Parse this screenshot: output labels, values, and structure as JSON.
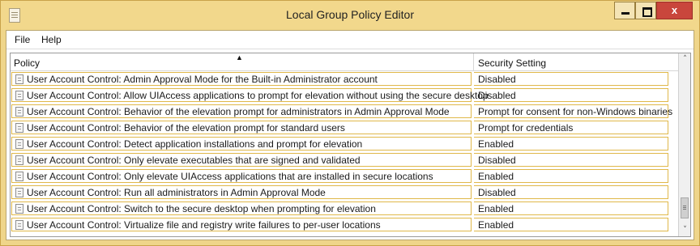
{
  "window": {
    "title": "Local Group Policy Editor",
    "close_glyph": "x",
    "icons": {
      "app": "document-icon",
      "minimize": "minimize-icon",
      "maximize": "maximize-icon",
      "close": "close-icon"
    }
  },
  "menu": {
    "items": [
      {
        "label": "File"
      },
      {
        "label": "Help"
      }
    ]
  },
  "table": {
    "columns": [
      "Policy",
      "Security Setting"
    ],
    "sort_indicator": "▲",
    "rows": [
      {
        "policy": "User Account Control: Admin Approval Mode for the Built-in Administrator account",
        "setting": "Disabled"
      },
      {
        "policy": "User Account Control: Allow UIAccess applications to prompt for elevation without using the secure desktop",
        "setting": "Disabled"
      },
      {
        "policy": "User Account Control: Behavior of the elevation prompt for administrators in Admin Approval Mode",
        "setting": "Prompt for consent for non-Windows binaries"
      },
      {
        "policy": "User Account Control: Behavior of the elevation prompt for standard users",
        "setting": "Prompt for credentials"
      },
      {
        "policy": "User Account Control: Detect application installations and prompt for elevation",
        "setting": "Enabled"
      },
      {
        "policy": "User Account Control: Only elevate executables that are signed and validated",
        "setting": "Disabled"
      },
      {
        "policy": "User Account Control: Only elevate UIAccess applications that are installed in secure locations",
        "setting": "Enabled"
      },
      {
        "policy": "User Account Control: Run all administrators in Admin Approval Mode",
        "setting": "Disabled"
      },
      {
        "policy": "User Account Control: Switch to the secure desktop when prompting for elevation",
        "setting": "Enabled"
      },
      {
        "policy": "User Account Control: Virtualize file and registry write failures to per-user locations",
        "setting": "Enabled"
      }
    ]
  },
  "scrollbar": {
    "up_glyph": "˄",
    "down_glyph": "˅"
  },
  "colors": {
    "title_bar": "#f2d88c",
    "row_border": "#e0b84a",
    "close_button": "#c9463c"
  }
}
